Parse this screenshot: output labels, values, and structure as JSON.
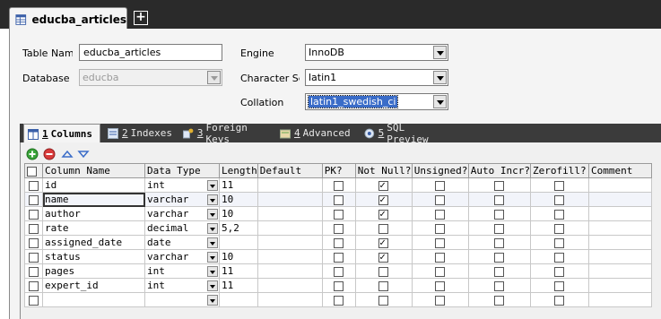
{
  "window": {
    "tab_title": "educba_articles",
    "new_tab_symbol": "+"
  },
  "form": {
    "table_name_label": "Table Nam",
    "table_name_value": "educba_articles",
    "database_label": "Database",
    "database_value": "educba",
    "engine_label": "Engine",
    "engine_value": "InnoDB",
    "charset_label": "Character Se",
    "charset_value": "latin1",
    "collation_label": "Collation",
    "collation_value": "latin1_swedish_ci"
  },
  "tabs": [
    {
      "num": "1",
      "label": "Columns",
      "icon": "columns-icon"
    },
    {
      "num": "2",
      "label": "Indexes",
      "icon": "indexes-icon"
    },
    {
      "num": "3",
      "label": "Foreign Keys",
      "icon": "foreign-keys-icon"
    },
    {
      "num": "4",
      "label": "Advanced",
      "icon": "advanced-icon"
    },
    {
      "num": "5",
      "label": "SQL Preview",
      "icon": "sql-preview-icon"
    }
  ],
  "grid": {
    "headers": [
      "Column Name",
      "Data Type",
      "Length",
      "Default",
      "PK?",
      "Not Null?",
      "Unsigned?",
      "Auto Incr?",
      "Zerofill?",
      "Comment"
    ],
    "rows": [
      {
        "name": " id",
        "type": "int",
        "length": "11",
        "pk": false,
        "not_null": true,
        "unsigned": false,
        "auto_incr": false,
        "zerofill": false
      },
      {
        "name": " name",
        "type": "varchar",
        "length": "10",
        "pk": false,
        "not_null": true,
        "unsigned": false,
        "auto_incr": false,
        "zerofill": false
      },
      {
        "name": " author",
        "type": "varchar",
        "length": "10",
        "pk": false,
        "not_null": true,
        "unsigned": false,
        "auto_incr": false,
        "zerofill": false
      },
      {
        "name": " rate",
        "type": "decimal",
        "length": "5,2",
        "pk": false,
        "not_null": false,
        "unsigned": false,
        "auto_incr": false,
        "zerofill": false
      },
      {
        "name": "assigned_date",
        "type": "date",
        "length": "",
        "pk": false,
        "not_null": true,
        "unsigned": false,
        "auto_incr": false,
        "zerofill": false
      },
      {
        "name": " status",
        "type": "varchar",
        "length": "10",
        "pk": false,
        "not_null": true,
        "unsigned": false,
        "auto_incr": false,
        "zerofill": false
      },
      {
        "name": " pages",
        "type": "int",
        "length": "11",
        "pk": false,
        "not_null": false,
        "unsigned": false,
        "auto_incr": false,
        "zerofill": false
      },
      {
        "name": "expert_id",
        "type": "int",
        "length": "11",
        "pk": false,
        "not_null": false,
        "unsigned": false,
        "auto_incr": false,
        "zerofill": false
      },
      {
        "name": "",
        "type": "",
        "length": "",
        "pk": false,
        "not_null": false,
        "unsigned": false,
        "auto_incr": false,
        "zerofill": false
      }
    ]
  }
}
